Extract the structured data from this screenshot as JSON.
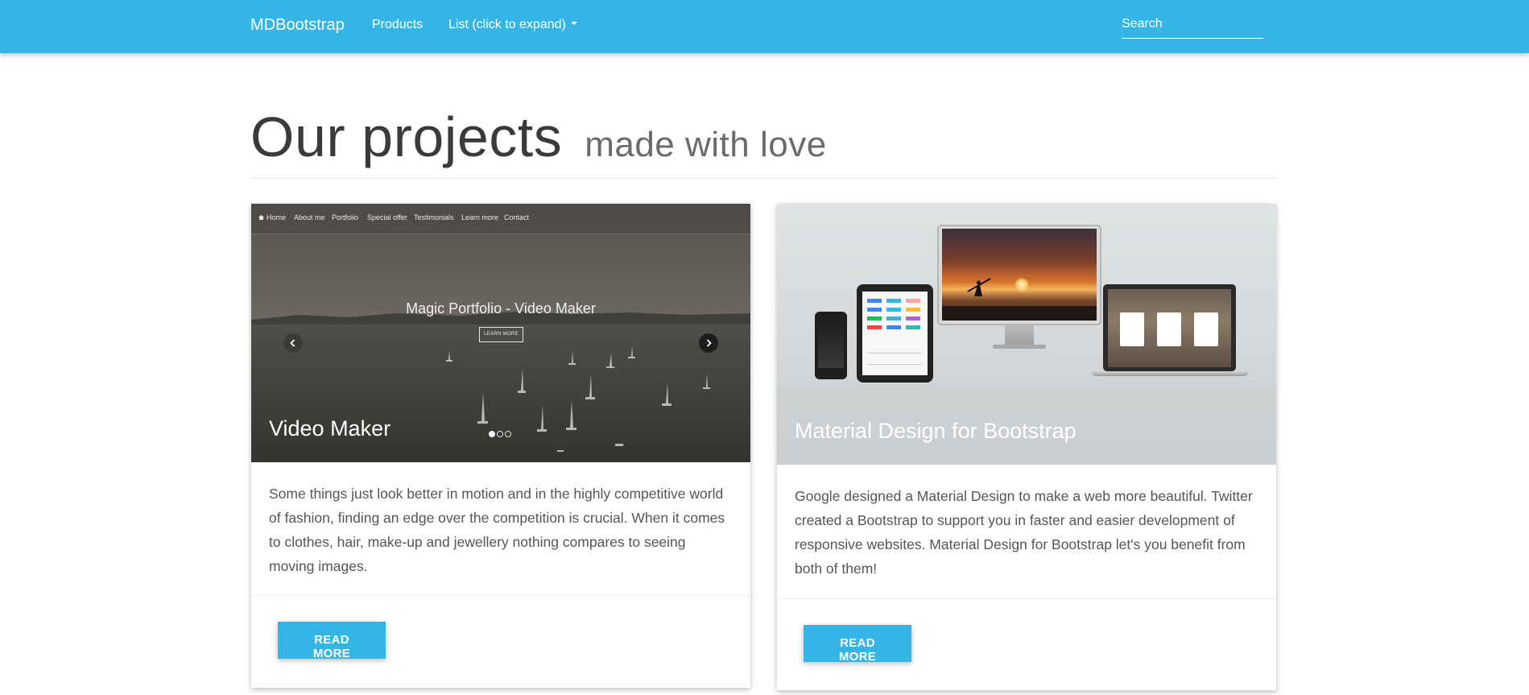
{
  "navbar": {
    "brand": "MDBootstrap",
    "products": "Products",
    "list": "List (click to expand)",
    "search_placeholder": "Search",
    "bg_color": "#33b5e5"
  },
  "header": {
    "title": "Our projects",
    "subtitle": "made with love"
  },
  "cards": [
    {
      "title": "Video Maker",
      "text": "Some things just look better in motion and in the highly competitive world of fashion, finding an edge over the competition is crucial. When it comes to clothes, hair, make-up and jewellery nothing compares to seeing moving images.",
      "button": "Read more",
      "preview": {
        "nav": [
          "Home",
          "About me",
          "Portfolio",
          "Special offer",
          "Testimonials",
          "Learn more",
          "Contact"
        ],
        "caption": "Magic Portfolio - Video Maker",
        "learn_more": "LEARN MORE",
        "prev_icon": "chevron-left-icon",
        "next_icon": "chevron-right-icon",
        "slides": 3,
        "active_slide": 1
      }
    },
    {
      "title": "Material Design for Bootstrap",
      "text": "Google designed a Material Design to make a web more beautiful. Twitter created a Bootstrap to support you in faster and easier development of responsive websites. Material Design for Bootstrap let's you benefit from both of them!",
      "button": "Read more"
    }
  ],
  "colors": {
    "accent": "#33b5e5"
  }
}
